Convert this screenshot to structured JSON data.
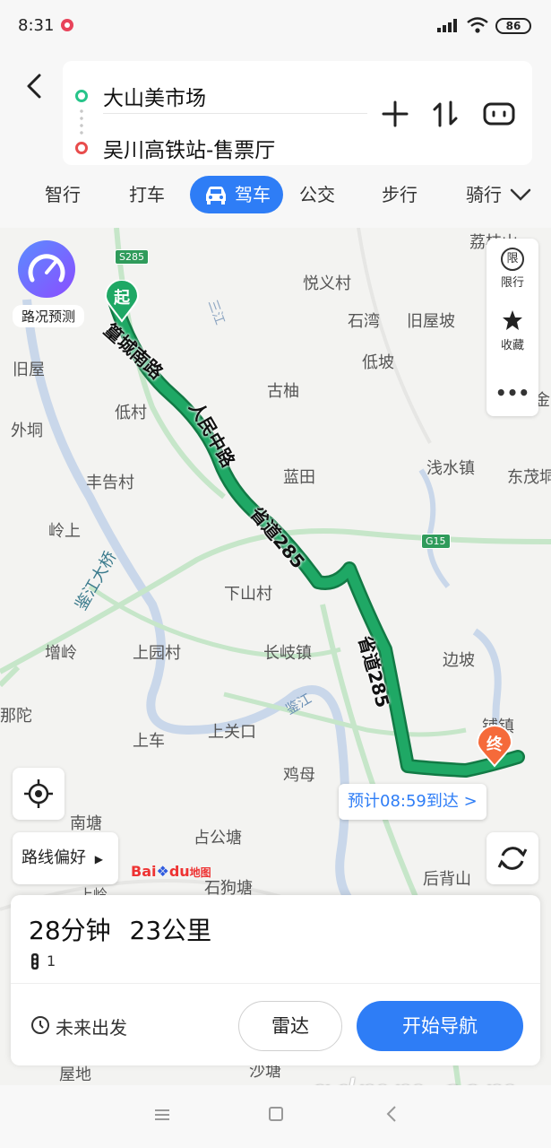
{
  "status_bar": {
    "time": "8:31",
    "battery": "86"
  },
  "route": {
    "origin": "大山美市场",
    "destination": "吴川高铁站-售票厅"
  },
  "tabs": [
    {
      "label": "智行"
    },
    {
      "label": "打车"
    },
    {
      "label": "驾车",
      "active": true
    },
    {
      "label": "公交"
    },
    {
      "label": "步行"
    },
    {
      "label": "骑行"
    }
  ],
  "map": {
    "traffic_label": "路况预测",
    "panel": {
      "limit_icon_text": "限",
      "limit_label": "限行",
      "favorite_label": "收藏",
      "more_label": "•••"
    },
    "start_label": "起",
    "end_label": "终",
    "eta": "预计08:59到达 >",
    "route_pref": "路线偏好",
    "baidu_logo": {
      "bai": "Bai",
      "du": "du",
      "map": "地图"
    },
    "roads": {
      "s285": "S285",
      "g15": "G15",
      "road1": "篁城南路",
      "road2": "人民中路",
      "road3": "省道285",
      "road4": "省道285"
    },
    "places": [
      "悦义村",
      "石湾",
      "旧屋坡",
      "旧屋",
      "低坡",
      "古柚",
      "低村",
      "外垌",
      "丰告村",
      "蓝田",
      "浅水镇",
      "东茂垌",
      "岭上",
      "下山村",
      "边坡",
      "增岭",
      "上园村",
      "长岐镇",
      "那陀",
      "上关口",
      "上车",
      "鸡母",
      "南塘",
      "占公塘",
      "石狗塘",
      "后背山",
      "上岭",
      "荔枝山",
      "下金",
      "鉴江大桥",
      "鉴江",
      "三江",
      "铺镇",
      "屋地",
      "沙塘"
    ]
  },
  "summary": {
    "duration": "28分钟",
    "distance": "23公里",
    "traffic_lights": "1",
    "depart_label": "未来出发",
    "radar_label": "雷达",
    "navigate_label": "开始导航"
  },
  "watermark": "gdmm.com",
  "colors": {
    "accent": "#2e7df6",
    "route": "#1fa865",
    "origin": "#27c48a",
    "destination": "#e84d4d",
    "end_marker": "#f56a3a"
  }
}
